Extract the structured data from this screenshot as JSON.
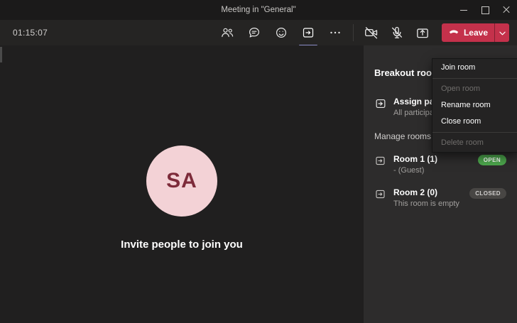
{
  "titlebar": {
    "title": "Meeting in \"General\""
  },
  "toolbar": {
    "timer": "01:15:07",
    "leave_label": "Leave"
  },
  "stage": {
    "avatar_initials": "SA",
    "invite_text": "Invite people to join you"
  },
  "panel": {
    "title": "Breakout rooms",
    "assign_title": "Assign participants",
    "assign_subtitle": "All participants",
    "manage_label": "Manage rooms",
    "rooms": [
      {
        "name": "Room 1 (1)",
        "subtitle": "- (Guest)",
        "badge": "OPEN",
        "status": "open"
      },
      {
        "name": "Room 2 (0)",
        "subtitle": "This room is empty",
        "badge": "CLOSED",
        "status": "closed"
      }
    ]
  },
  "context_menu": {
    "items": [
      {
        "label": "Join room",
        "enabled": true
      },
      {
        "label": "Open room",
        "enabled": false
      },
      {
        "label": "Rename room",
        "enabled": true
      },
      {
        "label": "Close room",
        "enabled": true
      },
      {
        "label": "Delete room",
        "enabled": false
      }
    ]
  },
  "colors": {
    "accent_purple": "#8b8cc7",
    "leave_red": "#c4314b",
    "badge_open_bg": "#4ca64c",
    "badge_closed_bg": "#484644",
    "avatar_bg": "#f3d2d6",
    "avatar_text": "#7d2b3a"
  }
}
